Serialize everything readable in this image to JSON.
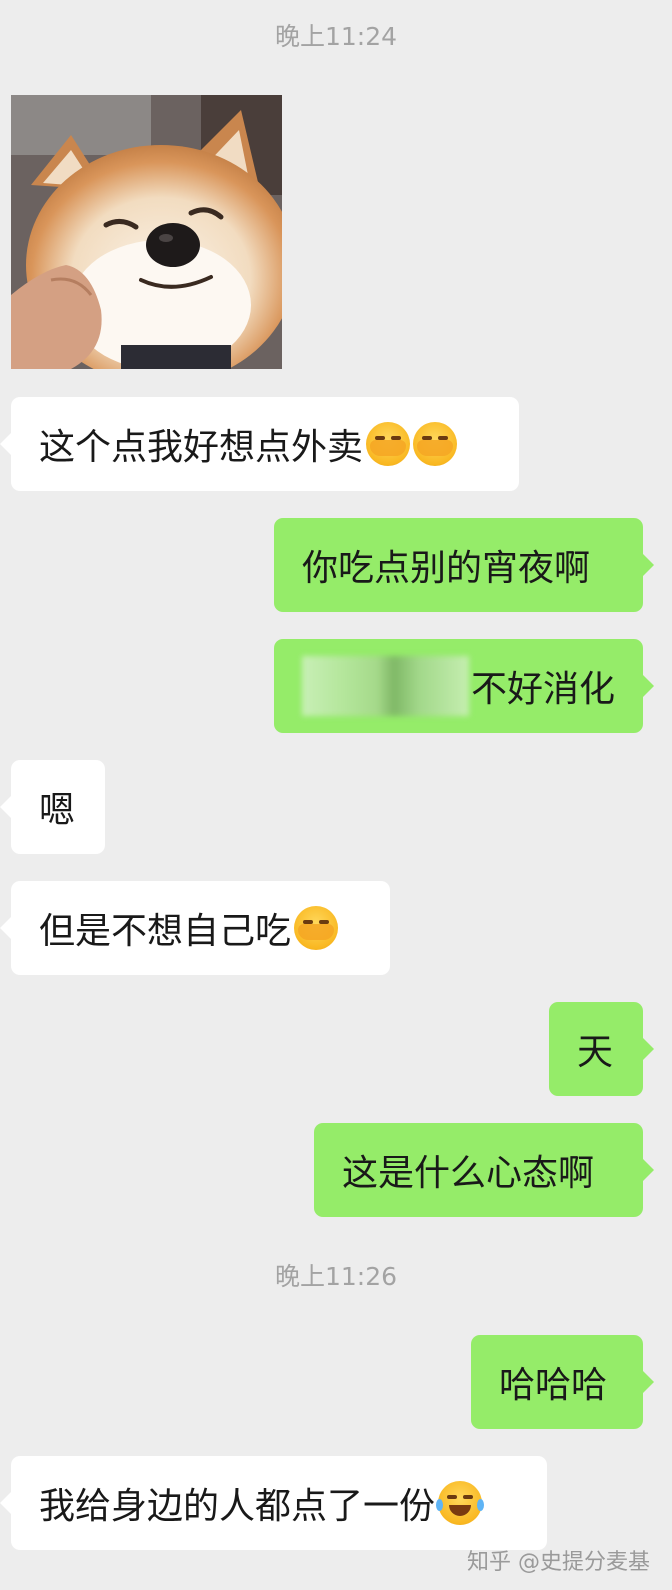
{
  "timestamps": [
    "晚上11:24",
    "晚上11:26"
  ],
  "messages": [
    {
      "side": "left",
      "type": "image",
      "alt": "shiba-inu-photo"
    },
    {
      "side": "left",
      "text": "这个点我好想点外卖",
      "emoji": [
        "facepalm-cry",
        "facepalm-cry"
      ]
    },
    {
      "side": "right",
      "text": "你吃点别的宵夜啊"
    },
    {
      "side": "right",
      "text": "不好消化",
      "redacted_prefix": true
    },
    {
      "side": "left",
      "text": "嗯"
    },
    {
      "side": "left",
      "text": "但是不想自己吃",
      "emoji": [
        "facepalm-cry"
      ]
    },
    {
      "side": "right",
      "text": "天"
    },
    {
      "side": "right",
      "text": "这是什么心态啊"
    },
    {
      "side": "right",
      "text": "哈哈哈"
    },
    {
      "side": "left",
      "text": "我给身边的人都点了一份",
      "emoji": [
        "tears-of-joy"
      ]
    }
  ],
  "watermark": "知乎 @史提分麦基",
  "colors": {
    "background": "#ededed",
    "bubble_left": "#ffffff",
    "bubble_right": "#95ec69",
    "timestamp": "#a3a3a3"
  }
}
